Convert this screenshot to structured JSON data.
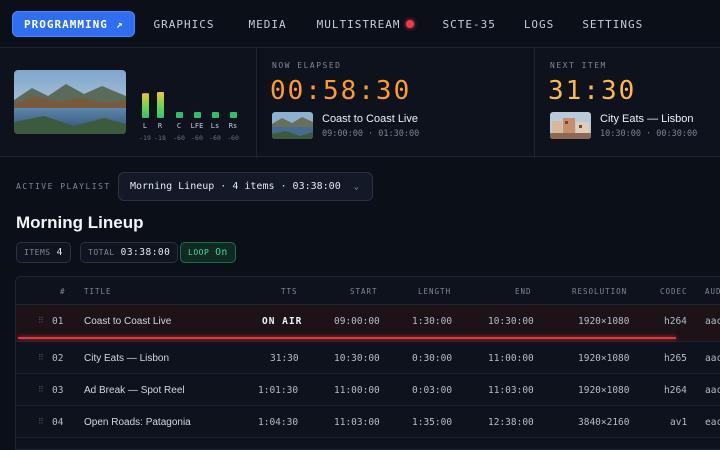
{
  "nav": {
    "tabs": [
      {
        "label": "PROGRAMMING",
        "active": true,
        "icon": "external-arrow-icon"
      },
      {
        "label": "GRAPHICS"
      },
      {
        "label": "MEDIA"
      },
      {
        "label": "MULTISTREAM",
        "badge": "live-dot"
      },
      {
        "label": "SCTE-35"
      },
      {
        "label": "LOGS"
      },
      {
        "label": "SETTINGS"
      }
    ]
  },
  "audio_meters": {
    "channels": [
      "L",
      "R",
      "C",
      "LFE",
      "Ls",
      "Rs"
    ],
    "db": [
      "-19",
      "-18",
      "-60",
      "-60",
      "-60",
      "-60"
    ],
    "levels": [
      0.62,
      0.65,
      0.12,
      0.12,
      0.12,
      0.12
    ]
  },
  "now": {
    "label": "NOW ELAPSED",
    "time": "00:58:30",
    "title": "Coast to Coast Live",
    "sub": "09:00:00 · 01:30:00"
  },
  "next": {
    "label": "NEXT ITEM",
    "time": "31:30",
    "title": "City Eats — Lisbon",
    "sub": "10:30:00 · 00:30:00"
  },
  "playlist": {
    "label": "ACTIVE PLAYLIST",
    "selected": "Morning Lineup · 4 items · 03:38:00",
    "title": "Morning Lineup",
    "chips": {
      "items_label": "ITEMS",
      "items_value": "4",
      "total_label": "TOTAL",
      "total_value": "03:38:00",
      "loop_label": "LOOP",
      "loop_value": "On"
    }
  },
  "table": {
    "headers": [
      "#",
      "TITLE",
      "TTS",
      "START",
      "LENGTH",
      "END",
      "RESOLUTION",
      "CODEC",
      "AUD"
    ],
    "rows": [
      {
        "num": "01",
        "title": "Coast to Coast Live",
        "tts": "ON AIR",
        "start": "09:00:00",
        "length": "1:30:00",
        "end": "10:30:00",
        "res": "1920×1080",
        "codec": "h264",
        "aud": "aac",
        "on_air": true
      },
      {
        "num": "02",
        "title": "City Eats — Lisbon",
        "tts": "31:30",
        "start": "10:30:00",
        "length": "0:30:00",
        "end": "11:00:00",
        "res": "1920×1080",
        "codec": "h265",
        "aud": "aac"
      },
      {
        "num": "03",
        "title": "Ad Break — Spot Reel",
        "tts": "1:01:30",
        "start": "11:00:00",
        "length": "0:03:00",
        "end": "11:03:00",
        "res": "1920×1080",
        "codec": "h264",
        "aud": "aac"
      },
      {
        "num": "04",
        "title": "Open Roads: Patagonia",
        "tts": "1:04:30",
        "start": "11:03:00",
        "length": "1:35:00",
        "end": "12:38:00",
        "res": "3840×2160",
        "codec": "av1",
        "aud": "eac"
      }
    ],
    "progress": 0.65
  },
  "colors": {
    "accent": "#2f6ef0",
    "elapsed": "#ff9a2e",
    "next": "#ffb84a",
    "onair": "#e5343f",
    "loop": "#4fd79a"
  }
}
